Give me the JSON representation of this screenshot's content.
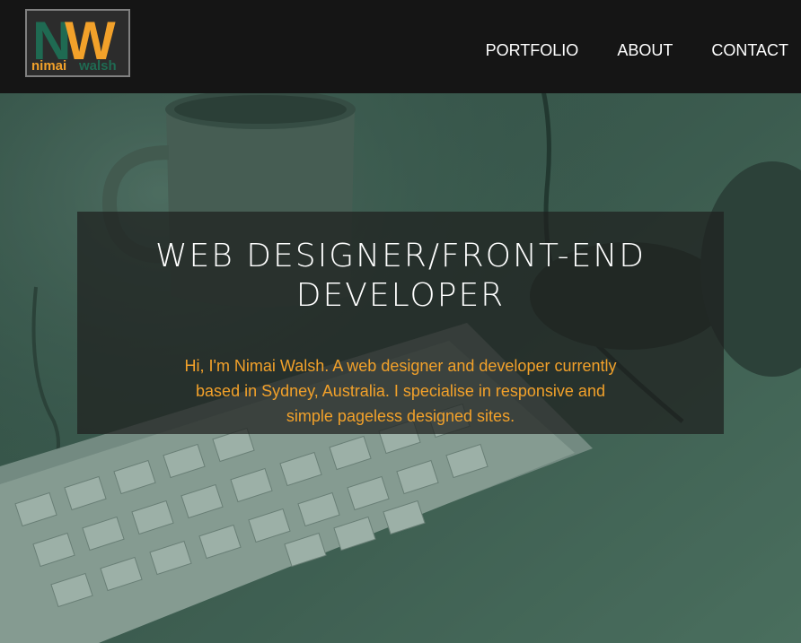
{
  "colors": {
    "navbar_bg": "#151515",
    "logo_green": "#1f6a52",
    "logo_orange": "#f2a12a",
    "accent_text": "#f2a12a",
    "hero_tint": "#3d5249"
  },
  "logo": {
    "initial_first": "N",
    "initial_last": "W",
    "first_name": "nimai",
    "last_name": "walsh"
  },
  "nav": {
    "items": [
      {
        "label": "PORTFOLIO"
      },
      {
        "label": "ABOUT"
      },
      {
        "label": "CONTACT"
      }
    ]
  },
  "hero": {
    "background_image": "desk-keyboard-mug-photo",
    "title_line1": "WEB DESIGNER/FRONT-END",
    "title_line2": "DEVELOPER",
    "intro": "Hi, I'm Nimai Walsh. A web designer and developer currently based in Sydney, Australia. I specialise in responsive and simple pageless designed sites."
  }
}
